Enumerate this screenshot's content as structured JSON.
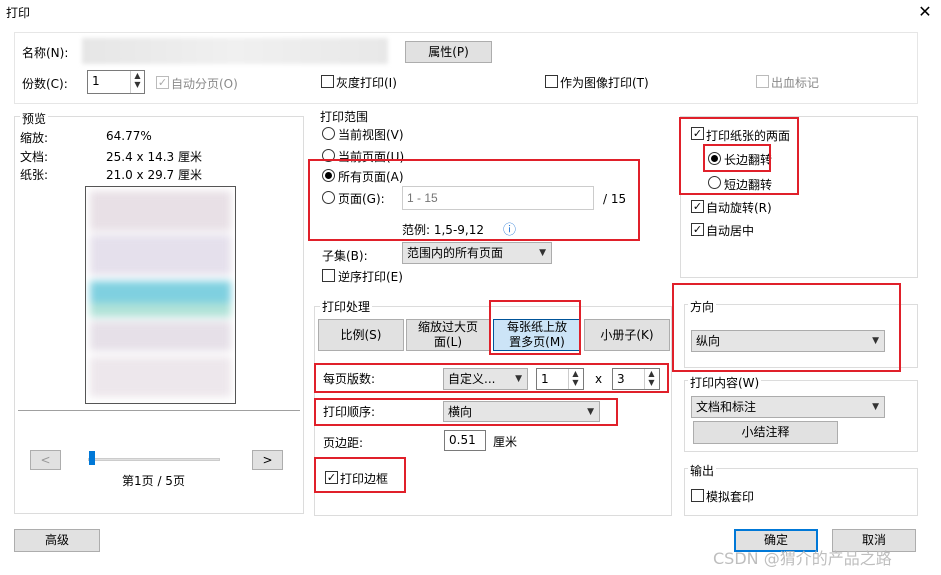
{
  "window": {
    "title": "打印",
    "close_glyph": "✕"
  },
  "top": {
    "name_label": "名称(N):",
    "properties_button": "属性(P)",
    "copies_label": "份数(C):",
    "copies_value": "1",
    "collate_label": "自动分页(O)",
    "grayscale_label": "灰度打印(I)",
    "print_as_image_label": "作为图像打印(T)",
    "bleed_label": "出血标记"
  },
  "preview": {
    "title": "预览",
    "zoom_label": "缩放:",
    "zoom_value": "64.77%",
    "doc_label": "文档:",
    "doc_value": "25.4 x 14.3 厘米",
    "paper_label": "纸张:",
    "paper_value": "21.0 x 29.7 厘米",
    "page_indicator": "第1页 / 5页",
    "prev_glyph": "<",
    "next_glyph": ">",
    "slider_position": 0
  },
  "range": {
    "title": "打印范围",
    "current_view": "当前视图(V)",
    "current_page": "当前页面(U)",
    "all_pages": "所有页面(A)",
    "pages_label": "页面(G):",
    "pages_placeholder": "1 - 15",
    "total": "/ 15",
    "example": "范例: 1,5-9,12",
    "info_glyph": "ⓘ",
    "subset_label": "子集(B):",
    "subset_value": "范围内的所有页面",
    "reverse_label": "逆序打印(E)"
  },
  "handling": {
    "title": "打印处理",
    "tab_scale": "比例(S)",
    "tab_fit": "缩放过大页面(L)",
    "tab_multi": "每张纸上放置多页(M)",
    "tab_booklet": "小册子(K)",
    "per_page_label": "每页版数:",
    "per_page_value": "自定义...",
    "cols": "1",
    "x": "x",
    "rows": "3",
    "order_label": "打印顺序:",
    "order_value": "横向",
    "margin_label": "页边距:",
    "margin_value": "0.51",
    "margin_unit": "厘米",
    "border_label": "打印边框"
  },
  "duplex": {
    "both_sides": "打印纸张的两面",
    "long_edge": "长边翻转",
    "short_edge": "短边翻转",
    "auto_rotate": "自动旋转(R)",
    "auto_center": "自动居中"
  },
  "orientation": {
    "title": "方向",
    "value": "纵向"
  },
  "content": {
    "title": "打印内容(W)",
    "value": "文档和标注",
    "summary_button": "小结注释"
  },
  "output": {
    "title": "输出",
    "simulate_label": "模拟套印"
  },
  "footer": {
    "advanced": "高级",
    "ok": "确定",
    "cancel": "取消",
    "watermark": "CSDN @猬介的产品之路"
  },
  "glyphs": {
    "check": "✓",
    "down": "▼",
    "up_small": "▲",
    "down_small": "▼"
  }
}
